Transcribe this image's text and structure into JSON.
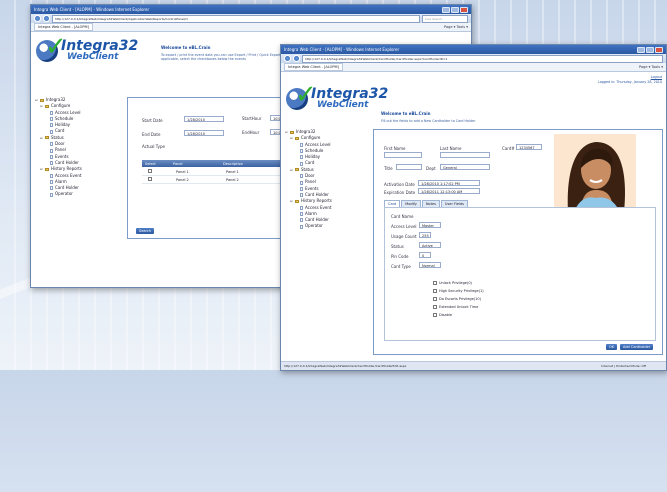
{
  "colors": {
    "accent": "#2a57a2",
    "brand": "#1d56a8",
    "check": "#2fae2f",
    "panel_border": "#7c9bc8"
  },
  "back_window": {
    "title": "Integra Web Client - [ALOPM] - Windows Internet Explorer",
    "url": "http://127.0.0.1/IntegraWeb/Integra32WebClient/ApplicationWeb/Reports/ControlPanel/cl",
    "search_placeholder": "Live Search",
    "tab_label": "Integra Web Client - [ALOPM]",
    "commands": "Page ▾  Tools ▾",
    "logo": {
      "name": "Integra32",
      "sub": "WebClient",
      "mark": "PRO"
    },
    "welcome": "Welcome to eBL.Crain",
    "instructions": "To export / print the event data you can use Export / Print / Quick Export. If applicable, select the checkboxes below the events",
    "tree": [
      {
        "label": "Integra32",
        "type": "folder",
        "level": 0
      },
      {
        "label": "Configure",
        "type": "folder",
        "level": 1
      },
      {
        "label": "Access Level",
        "type": "page",
        "level": 2
      },
      {
        "label": "Schedule",
        "type": "page",
        "level": 2
      },
      {
        "label": "Holiday",
        "type": "page",
        "level": 2
      },
      {
        "label": "Card",
        "type": "page",
        "level": 2
      },
      {
        "label": "Status",
        "type": "folder",
        "level": 1
      },
      {
        "label": "Door",
        "type": "page",
        "level": 2
      },
      {
        "label": "Panel",
        "type": "page",
        "level": 2
      },
      {
        "label": "Events",
        "type": "page",
        "level": 2
      },
      {
        "label": "Card Holder",
        "type": "page",
        "level": 2
      },
      {
        "label": "History Reports",
        "type": "folder",
        "level": 1
      },
      {
        "label": "Access Event",
        "type": "page",
        "level": 2
      },
      {
        "label": "Alarm",
        "type": "page",
        "level": 2
      },
      {
        "label": "Card Holder",
        "type": "page",
        "level": 2
      },
      {
        "label": "Operator",
        "type": "page",
        "level": 2
      }
    ],
    "form": {
      "start_date_label": "Start Date",
      "start_date": "1/28/2010",
      "start_time_label": "StartHour",
      "start_time": "10:00",
      "end_date_label": "End Date",
      "end_date": "1/28/2010",
      "end_time_label": "EndHour",
      "end_time": "10:00",
      "actual_type_label": "Actual Type",
      "columns": [
        "Select",
        "Panel",
        "Description"
      ],
      "rows": [
        [
          "Panel 1",
          "Panel 1"
        ],
        [
          "Panel 2",
          "Panel 2"
        ]
      ],
      "search_button": "Search"
    }
  },
  "front_window": {
    "title": "Integra Web Client - [ALOPM] - Windows Internet Explorer",
    "url": "http://127.0.0.1/IntegraWeb/Integra32WebClient/CardHolder/CardHolder.aspx?CardHolderID=1",
    "tab_label": "Integra Web Client - [ALOPM]",
    "commands": "Page ▾  Tools ▾",
    "logo": {
      "name": "Integra32",
      "sub": "WebClient",
      "mark": "PRO"
    },
    "logged_in": "Logged in: Thursday, January 28, 2010",
    "logout": "Logout",
    "welcome": "Welcome to eBL.Crain",
    "instructions": "Fill out the fields to add a New Cardholder to Card Holder",
    "tree": [
      {
        "label": "Integra32",
        "type": "folder",
        "level": 0
      },
      {
        "label": "Configure",
        "type": "folder",
        "level": 1
      },
      {
        "label": "Access Level",
        "type": "page",
        "level": 2
      },
      {
        "label": "Schedule",
        "type": "page",
        "level": 2
      },
      {
        "label": "Holiday",
        "type": "page",
        "level": 2
      },
      {
        "label": "Card",
        "type": "page",
        "level": 2
      },
      {
        "label": "Status",
        "type": "folder",
        "level": 1
      },
      {
        "label": "Door",
        "type": "page",
        "level": 2
      },
      {
        "label": "Panel",
        "type": "page",
        "level": 2
      },
      {
        "label": "Events",
        "type": "page",
        "level": 2
      },
      {
        "label": "Card Holder",
        "type": "page",
        "level": 2
      },
      {
        "label": "History Reports",
        "type": "folder",
        "level": 1
      },
      {
        "label": "Access Event",
        "type": "page",
        "level": 2
      },
      {
        "label": "Alarm",
        "type": "page",
        "level": 2
      },
      {
        "label": "Card Holder",
        "type": "page",
        "level": 2
      },
      {
        "label": "Operator",
        "type": "page",
        "level": 2
      }
    ],
    "form": {
      "first_name_label": "First Name",
      "first_name": "",
      "last_name_label": "Last Name",
      "last_name": "",
      "card_label": "Card#",
      "card": "1234567",
      "title_label": "Title",
      "title_value": "",
      "dept_label": "Dept",
      "dept_value": "General",
      "activation_label": "Activation Date",
      "activation_value": "1/28/2010 1:17:02 PM",
      "expiration_label": "Expiration Date",
      "expiration_value": "1/28/2011 12:13:00 AM",
      "tabs": [
        "Card",
        "Modify",
        "Notes",
        "User Fields"
      ],
      "card_name_label": "Card Name",
      "access_level_label": "Access Level",
      "access_level": "Master",
      "usage_count_label": "Usage Count",
      "usage_count": "255",
      "status_label": "Status",
      "status": "Active",
      "pin_label": "Pin Code",
      "pin": "0",
      "card_type_label": "Card Type",
      "card_type": "Normal",
      "options": [
        "Unlock Privilege(0)",
        "High Security Privilege(1)",
        "Do Escorts Privilege(10)",
        "Extended Unlock Time",
        "Disable"
      ],
      "save_button": "OK",
      "cancel_button": "Add Cardholder"
    },
    "status_bar": "http://127.0.0.1/IntegraWeb/Integra32WebClient/CardHolder/CardHolderEdit.aspx",
    "zone": "Internet | Protected Mode: Off"
  }
}
